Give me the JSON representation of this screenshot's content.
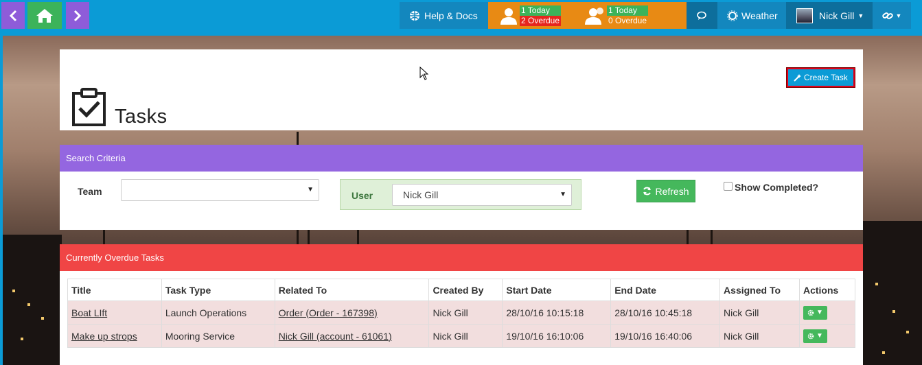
{
  "topbar": {
    "help_label": "Help & Docs",
    "my_tasks": {
      "today": "1 Today",
      "overdue": "2 Overdue"
    },
    "team_tasks": {
      "today": "1 Today",
      "overdue": "0 Overdue"
    },
    "weather_label": "Weather",
    "user_name": "Nick Gill"
  },
  "header": {
    "title": "Tasks",
    "create_task_label": "Create Task"
  },
  "search": {
    "heading": "Search Criteria",
    "team_label": "Team",
    "team_value": "",
    "user_label": "User",
    "user_value": "Nick Gill",
    "refresh_label": "Refresh",
    "show_completed_label": "Show Completed?"
  },
  "overdue": {
    "heading": "Currently Overdue Tasks",
    "columns": [
      "Title",
      "Task Type",
      "Related To",
      "Created By",
      "Start Date",
      "End Date",
      "Assigned To",
      "Actions"
    ],
    "rows": [
      {
        "title": "Boat LIft",
        "task_type": "Launch Operations",
        "related_to": "Order (Order - 167398)",
        "created_by": "Nick Gill",
        "start_date": "28/10/16 10:15:18",
        "end_date": "28/10/16 10:45:18",
        "assigned_to": "Nick Gill"
      },
      {
        "title": "Make up strops",
        "task_type": "Mooring Service",
        "related_to": "Nick Gill (account - 61061)",
        "created_by": "Nick Gill",
        "start_date": "19/10/16 16:10:06",
        "end_date": "19/10/16 16:40:06",
        "assigned_to": "Nick Gill"
      }
    ]
  }
}
